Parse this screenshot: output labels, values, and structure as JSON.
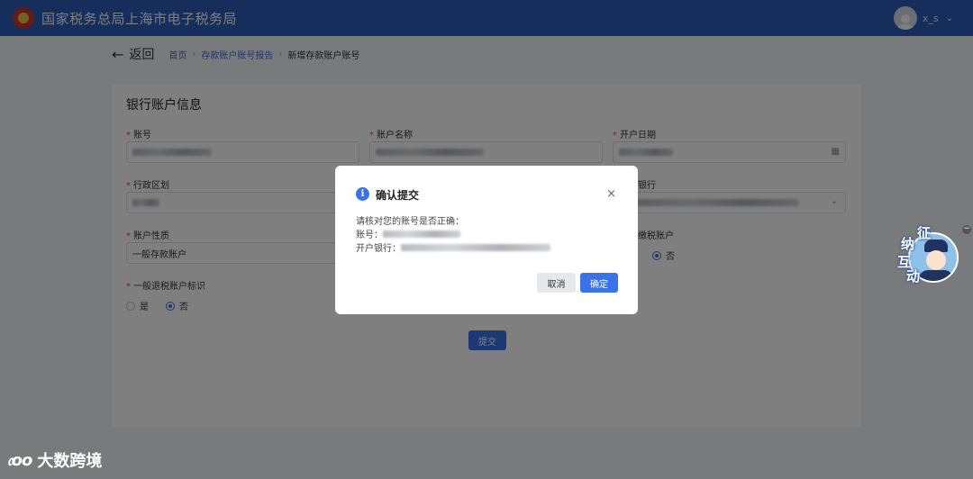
{
  "header": {
    "title": "国家税务总局上海市电子税务局",
    "user_name": "x_s"
  },
  "breadcrumb": {
    "back_label": "返回",
    "items": [
      "首页",
      "存款账户账号报告",
      "新增存款账户账号"
    ]
  },
  "form": {
    "title": "银行账户信息",
    "fields": {
      "account_no": {
        "label": "账号"
      },
      "account_name": {
        "label": "账户名称"
      },
      "open_date": {
        "label": "开户日期"
      },
      "admin_region": {
        "label": "行政区划"
      },
      "bank": {
        "label_partial": "银行"
      },
      "account_type": {
        "label": "账户性质",
        "value": "一般存款账户"
      },
      "tax_account": {
        "label_partial": "缴税账户",
        "options": [
          "否"
        ],
        "selected": "否"
      },
      "refund_flag": {
        "label": "一般退税账户标识",
        "options": [
          "是",
          "否"
        ],
        "selected": "否"
      }
    },
    "submit_label": "提交"
  },
  "dialog": {
    "title": "确认提交",
    "message": "请核对您的账号是否正确：",
    "account_label": "账号：",
    "bank_label": "开户银行：",
    "cancel_label": "取消",
    "confirm_label": "确定"
  },
  "widget": {
    "chars": [
      "征",
      "纳",
      "互",
      "动"
    ]
  },
  "watermark": {
    "text": "大数跨境"
  },
  "colors": {
    "header": "#2d5cb8",
    "primary": "#3a73e8",
    "required": "#e74c3c"
  }
}
